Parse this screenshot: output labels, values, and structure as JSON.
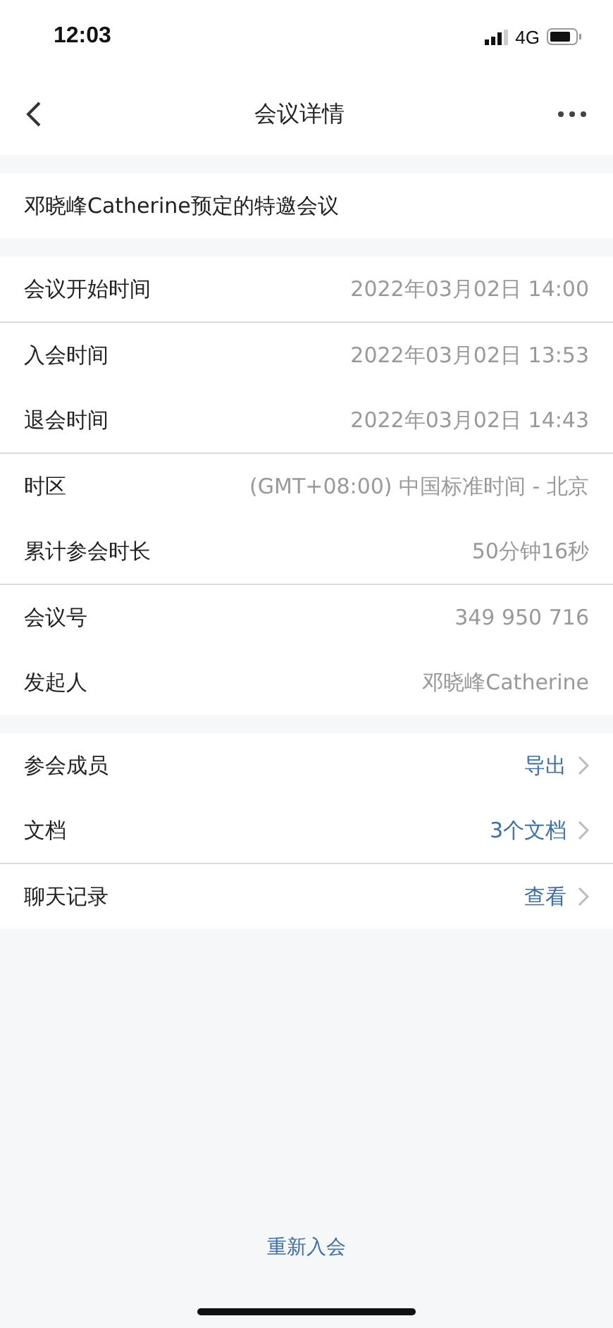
{
  "status_bar": {
    "time": "12:03",
    "network": "4G"
  },
  "nav": {
    "title": "会议详情"
  },
  "meeting_title": "邓晓峰Catherine预定的特邀会议",
  "detail_groups": [
    [
      {
        "label": "会议开始时间",
        "value": "2022年03月02日 14:00"
      }
    ],
    [
      {
        "label": "入会时间",
        "value": "2022年03月02日 13:53"
      },
      {
        "label": "退会时间",
        "value": "2022年03月02日 14:43"
      }
    ],
    [
      {
        "label": "时区",
        "value": "(GMT+08:00) 中国标准时间 - 北京"
      },
      {
        "label": "累计参会时长",
        "value": "50分钟16秒"
      }
    ],
    [
      {
        "label": "会议号",
        "value": "349 950 716"
      },
      {
        "label": "发起人",
        "value": "邓晓峰Catherine"
      }
    ]
  ],
  "link_groups": [
    [
      {
        "label": "参会成员",
        "action": "导出"
      },
      {
        "label": "文档",
        "action": "3个文档"
      }
    ],
    [
      {
        "label": "聊天记录",
        "action": "查看"
      }
    ]
  ],
  "rejoin_button": "重新入会"
}
